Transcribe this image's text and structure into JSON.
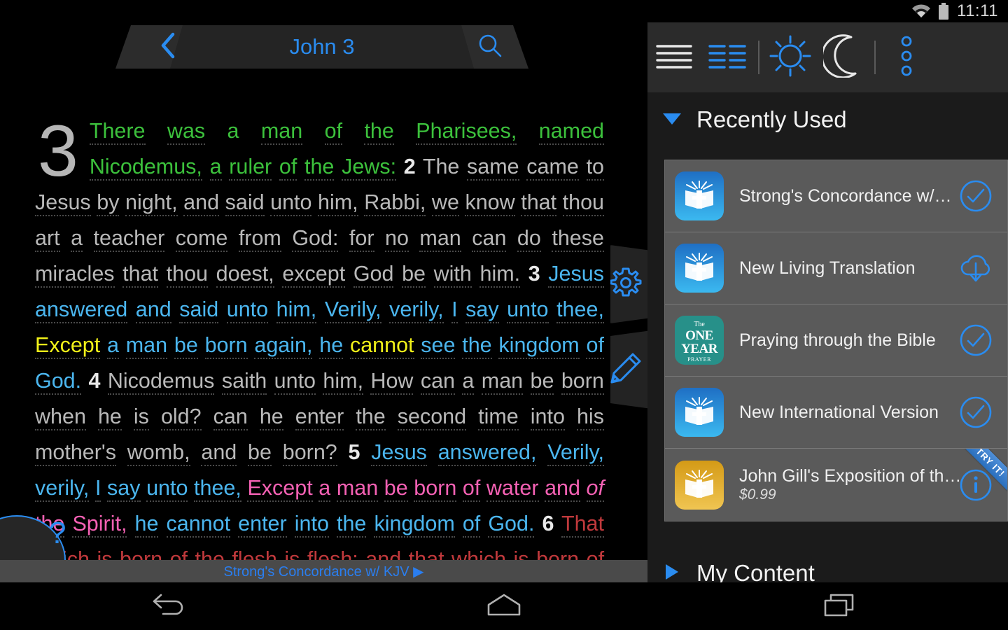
{
  "status_bar": {
    "time": "11:11",
    "wifi_icon": "wifi-icon",
    "battery_icon": "battery-icon"
  },
  "reader": {
    "back_icon": "chevron-left-icon",
    "chapter_title": "John 3",
    "search_icon": "search-icon",
    "settings_icon": "gear-icon",
    "notes_icon": "pencil-icon",
    "help_label": "?",
    "resource_bar_label": "Strong's Concordance w/ KJV ▶",
    "drop_cap": "3",
    "verses": [
      {
        "num": "",
        "color": "green",
        "text": "There was a man of the Pharisees, named Nicodemus, a ruler of the Jews:"
      },
      {
        "num": "2",
        "color": "plain",
        "text": "The same came to Jesus by night, and said unto him, Rabbi, we know that thou art a teacher come from God: for no man can do these miracles that thou doest, except God be with him."
      },
      {
        "num": "3",
        "color": "blue",
        "text": "Jesus answered and said unto him, Verily, verily, I say unto thee, Except a man be born again, he cannot see the kingdom of God.",
        "highlight_words": [
          "Except",
          "cannot"
        ]
      },
      {
        "num": "4",
        "color": "plain",
        "text": "Nicodemus saith unto him, How can a man be born when he is old? can he enter the second time into his mother's womb, and be born?"
      },
      {
        "num": "5",
        "color": "blue",
        "text": "Jesus answered, Verily, verily, I say unto thee, Except a man be born of water and of the Spirit, he cannot enter into the kingdom of God.",
        "pink_phrase": "Except a man be born of water and of the Spirit,"
      },
      {
        "num": "6",
        "color": "red",
        "text": "That which is born of the flesh is flesh; and that which is born of the Spirit is"
      }
    ]
  },
  "panel": {
    "toolbar": [
      {
        "name": "menu-icon",
        "label": "Menu"
      },
      {
        "name": "split-view-icon",
        "label": "Split View"
      },
      {
        "name": "sun-icon",
        "label": "Day Mode"
      },
      {
        "name": "moon-icon",
        "label": "Night Mode"
      },
      {
        "name": "more-vertical-icon",
        "label": "More Options"
      }
    ],
    "sections": [
      {
        "title": "Recently Used",
        "expanded": true,
        "arrow": "triangle-down-icon"
      },
      {
        "title": "My Content",
        "expanded": false,
        "arrow": "triangle-right-icon"
      }
    ],
    "resources": [
      {
        "title": "Strong's Concordance w/…",
        "price": "",
        "icon": "book-icon-blue",
        "action": "check-circle-icon",
        "ribbon": ""
      },
      {
        "title": "New Living Translation",
        "price": "",
        "icon": "book-icon-blue",
        "action": "cloud-download-icon",
        "ribbon": ""
      },
      {
        "title": "Praying through the Bible",
        "price": "",
        "icon": "one-year-prayer-icon",
        "action": "check-circle-icon",
        "ribbon": "",
        "icon_lines": [
          "The",
          "ONE",
          "YEAR",
          "PRAYER"
        ]
      },
      {
        "title": "New International Version",
        "price": "",
        "icon": "book-icon-blue",
        "action": "check-circle-icon",
        "ribbon": ""
      },
      {
        "title": "John Gill's Exposition of th…",
        "price": "$0.99",
        "icon": "book-icon-gold",
        "action": "info-circle-icon",
        "ribbon": "TRY IT!"
      }
    ]
  },
  "nav_bar": [
    {
      "name": "back-nav-icon",
      "label": "Back"
    },
    {
      "name": "home-nav-icon",
      "label": "Home"
    },
    {
      "name": "recents-nav-icon",
      "label": "Recents"
    }
  ],
  "colors": {
    "accent_blue": "#2a8cf0",
    "green_text": "#3cc13c",
    "blue_text": "#4bb6ef",
    "yellow_text": "#f2f219",
    "pink_text": "#f561b4",
    "red_text": "#c0393c",
    "plain_text": "#b9b9b9"
  }
}
